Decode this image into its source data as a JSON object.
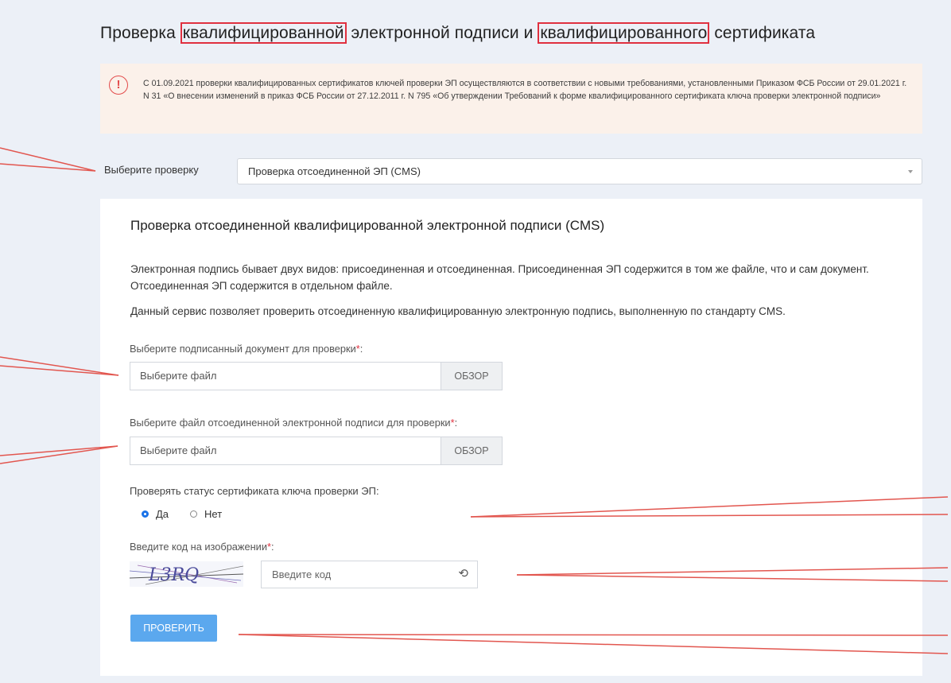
{
  "title": {
    "part1": "Проверка ",
    "hl1": "квалифицированной",
    "part2": " электронной подписи и ",
    "hl2": "квалифицированного",
    "part3": " сертификата"
  },
  "notice": {
    "icon": "warning-circle-icon",
    "text": "С 01.09.2021 проверки квалифицированных сертификатов ключей проверки ЭП осуществляются в соответствии с новыми требованиями, установленными Приказом ФСБ России от 29.01.2021 г. N 31 «О внесении изменений в приказ ФСБ России от 27.12.2011 г. N 795 «Об утверждении Требований к форме квалифицированного сертификата ключа проверки электронной подписи»"
  },
  "check_select": {
    "label": "Выберите проверку",
    "value": "Проверка отсоединенной ЭП (CMS)"
  },
  "card": {
    "title": "Проверка отсоединенной квалифицированной электронной подписи (CMS)",
    "desc1": "Электронная подпись бывает двух видов: присоединенная и отсоединенная. Присоединенная ЭП содержится в том же файле, что и сам документ. Отсоединенная ЭП содержится в отдельном файле.",
    "desc2": "Данный сервис позволяет проверить отсоединенную квалифицированную электронную подпись, выполненную по стандарту CMS.",
    "doc_label": "Выберите подписанный документ для проверки",
    "sig_label": "Выберите файл отсоединенной электронной подписи для проверки",
    "required_mark": "*",
    "colon": ":",
    "file_placeholder": "Выберите файл",
    "browse": "ОБЗОР",
    "status_label": "Проверять статус сертификата ключа проверки ЭП:",
    "radio_yes": "Да",
    "radio_no": "Нет",
    "radio_selected": "Да",
    "captcha_label": "Введите код на изображении",
    "captcha_text": "L3RQ",
    "captcha_placeholder": "Введите код",
    "submit": "ПРОВЕРИТЬ"
  },
  "colors": {
    "page_bg": "#ecf0f7",
    "notice_bg": "#fbf1ea",
    "accent": "#5ba8ee",
    "highlight": "#e0303f"
  }
}
